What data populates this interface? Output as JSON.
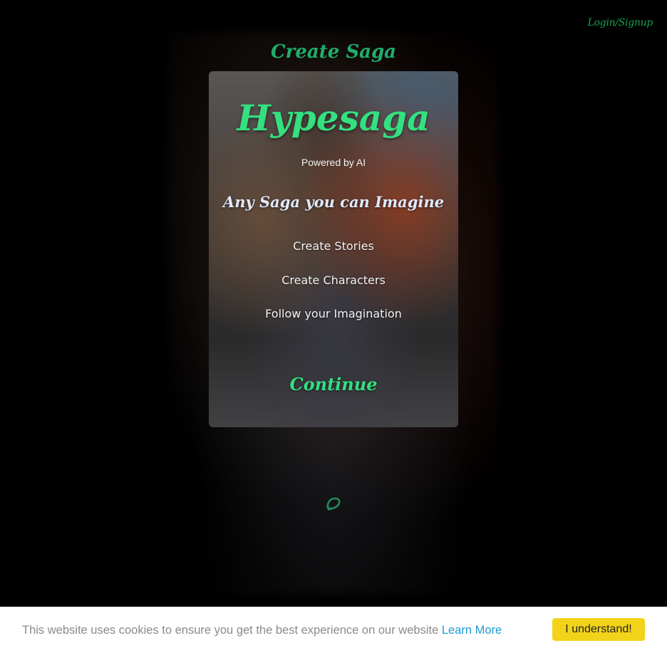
{
  "header": {
    "login_signup": "Login/Signup",
    "title": "Create Saga"
  },
  "card": {
    "brand": "Hypesaga",
    "powered_by": "Powered by AI",
    "tagline": "Any Saga you can Imagine",
    "features": [
      "Create Stories",
      "Create Characters",
      "Follow your Imagination"
    ],
    "continue_label": "Continue"
  },
  "loading": {
    "icon": "spinner-icon"
  },
  "cookie": {
    "message": "This website uses cookies to ensure you get the best experience on our website",
    "learn_more": "Learn More",
    "accept_label": "I understand!"
  },
  "colors": {
    "accent_green": "#34e07f",
    "dark_green": "#16a34a",
    "cookie_button": "#f2d31a",
    "link_blue": "#1e9ad6"
  }
}
